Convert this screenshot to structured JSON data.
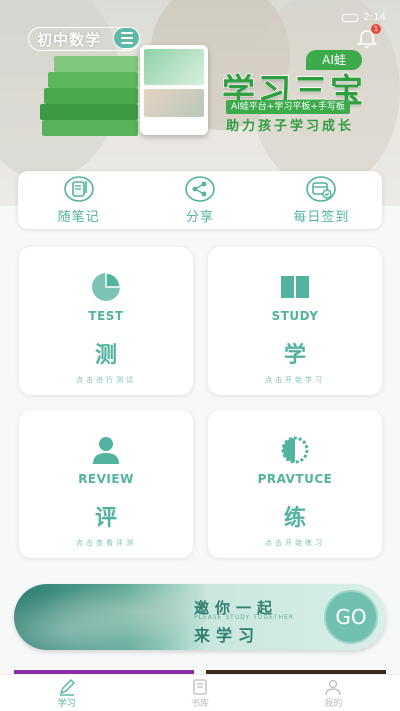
{
  "colors": {
    "accent": "#52b3a0",
    "brand_green": "#3dab4c"
  },
  "banner": {
    "grade_label": "初中数学",
    "status_right": "2:14",
    "notification_count": "1",
    "ai_badge": "AI蛙",
    "slogan": "学习三宝",
    "slogan_sub": "AI蛙平台+学习平板+手写板",
    "slogan_tag": "助力孩子学习成长"
  },
  "quickbar": [
    {
      "label": "随笔记",
      "icon": "notebook-icon"
    },
    {
      "label": "分享",
      "icon": "share-icon"
    },
    {
      "label": "每日签到",
      "icon": "checkin-icon"
    }
  ],
  "cards": {
    "test": {
      "en": "TEST",
      "zh": "测",
      "hint": "点击进行测试",
      "icon": "pie-chart-icon"
    },
    "study": {
      "en": "STUDY",
      "zh": "学",
      "hint": "点击开始学习",
      "icon": "book-icon"
    },
    "review": {
      "en": "REVIEW",
      "zh": "评",
      "hint": "点击查看评测",
      "icon": "person-icon"
    },
    "practice": {
      "en": "PRAVTUCE",
      "zh": "练",
      "hint": "点击开始练习",
      "icon": "half-gear-icon"
    }
  },
  "invite": {
    "line1": "邀你一起",
    "line2": "PLEASE STUDY TOGETHER",
    "line3": "来学习",
    "go_label": "GO"
  },
  "nav": [
    {
      "label": "学习",
      "icon": "pen-icon",
      "active": true
    },
    {
      "label": "书库",
      "icon": "library-icon",
      "active": false
    },
    {
      "label": "我的",
      "icon": "profile-icon",
      "active": false
    }
  ]
}
